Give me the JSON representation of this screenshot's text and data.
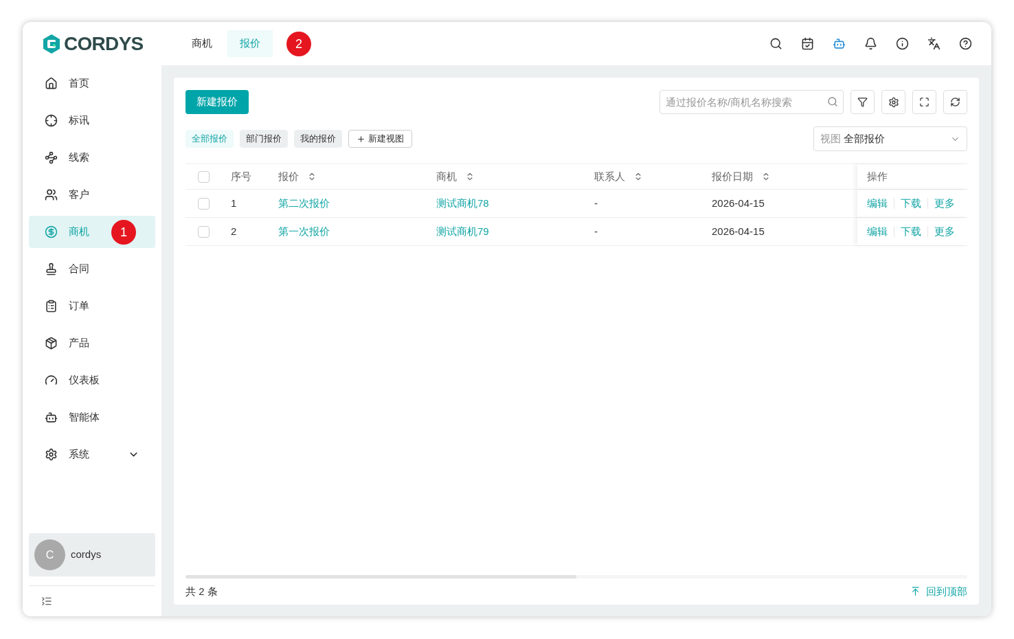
{
  "logo": {
    "text": "CORDYS"
  },
  "top_tabs": [
    {
      "label": "商机",
      "selected": false
    },
    {
      "label": "报价",
      "selected": true
    }
  ],
  "top_badge": "2",
  "sidebar": {
    "items": [
      {
        "kind": "link",
        "label": "首页",
        "selected": false
      },
      {
        "kind": "link",
        "label": "标讯",
        "selected": false
      },
      {
        "kind": "link",
        "label": "线索",
        "selected": false
      },
      {
        "kind": "link",
        "label": "客户",
        "selected": false
      },
      {
        "kind": "link",
        "label": "商机",
        "selected": true,
        "badge": "1"
      },
      {
        "kind": "link",
        "label": "合同",
        "selected": false
      },
      {
        "kind": "link",
        "label": "订单",
        "selected": false
      },
      {
        "kind": "link",
        "label": "产品",
        "selected": false
      },
      {
        "kind": "link",
        "label": "仪表板",
        "selected": false
      },
      {
        "kind": "link",
        "label": "智能体",
        "selected": false
      },
      {
        "kind": "group",
        "label": "系统",
        "selected": false
      }
    ],
    "user": {
      "initial": "C",
      "name": "cordys"
    }
  },
  "toolbar": {
    "new_button": "新建报价",
    "search": {
      "placeholder": "通过报价名称/商机名称搜索"
    }
  },
  "views": [
    {
      "label": "全部报价",
      "selected": true
    },
    {
      "label": "部门报价",
      "selected": false
    },
    {
      "label": "我的报价",
      "selected": false
    }
  ],
  "new_view_button": "新建视图",
  "view_select": {
    "prefix": "视图",
    "value": "全部报价"
  },
  "table": {
    "all_checked": false,
    "columns": [
      {
        "label": "序号",
        "sortable": false
      },
      {
        "label": "报价",
        "sortable": true
      },
      {
        "label": "商机",
        "sortable": true
      },
      {
        "label": "联系人",
        "sortable": true
      },
      {
        "label": "报价日期",
        "sortable": true
      },
      {
        "label": "操作",
        "sortable": false
      }
    ],
    "rows": [
      {
        "checked": false,
        "index": "1",
        "quote": "第二次报价",
        "opportunity": "测试商机78",
        "contact": "-",
        "date": "2026-04-15",
        "actions": [
          "编辑",
          "下载",
          "更多"
        ]
      },
      {
        "checked": false,
        "index": "2",
        "quote": "第一次报价",
        "opportunity": "测试商机79",
        "contact": "-",
        "date": "2026-04-15",
        "actions": [
          "编辑",
          "下载",
          "更多"
        ]
      }
    ]
  },
  "footer": {
    "total": "共 2 条",
    "back_to_top": "回到顶部"
  }
}
